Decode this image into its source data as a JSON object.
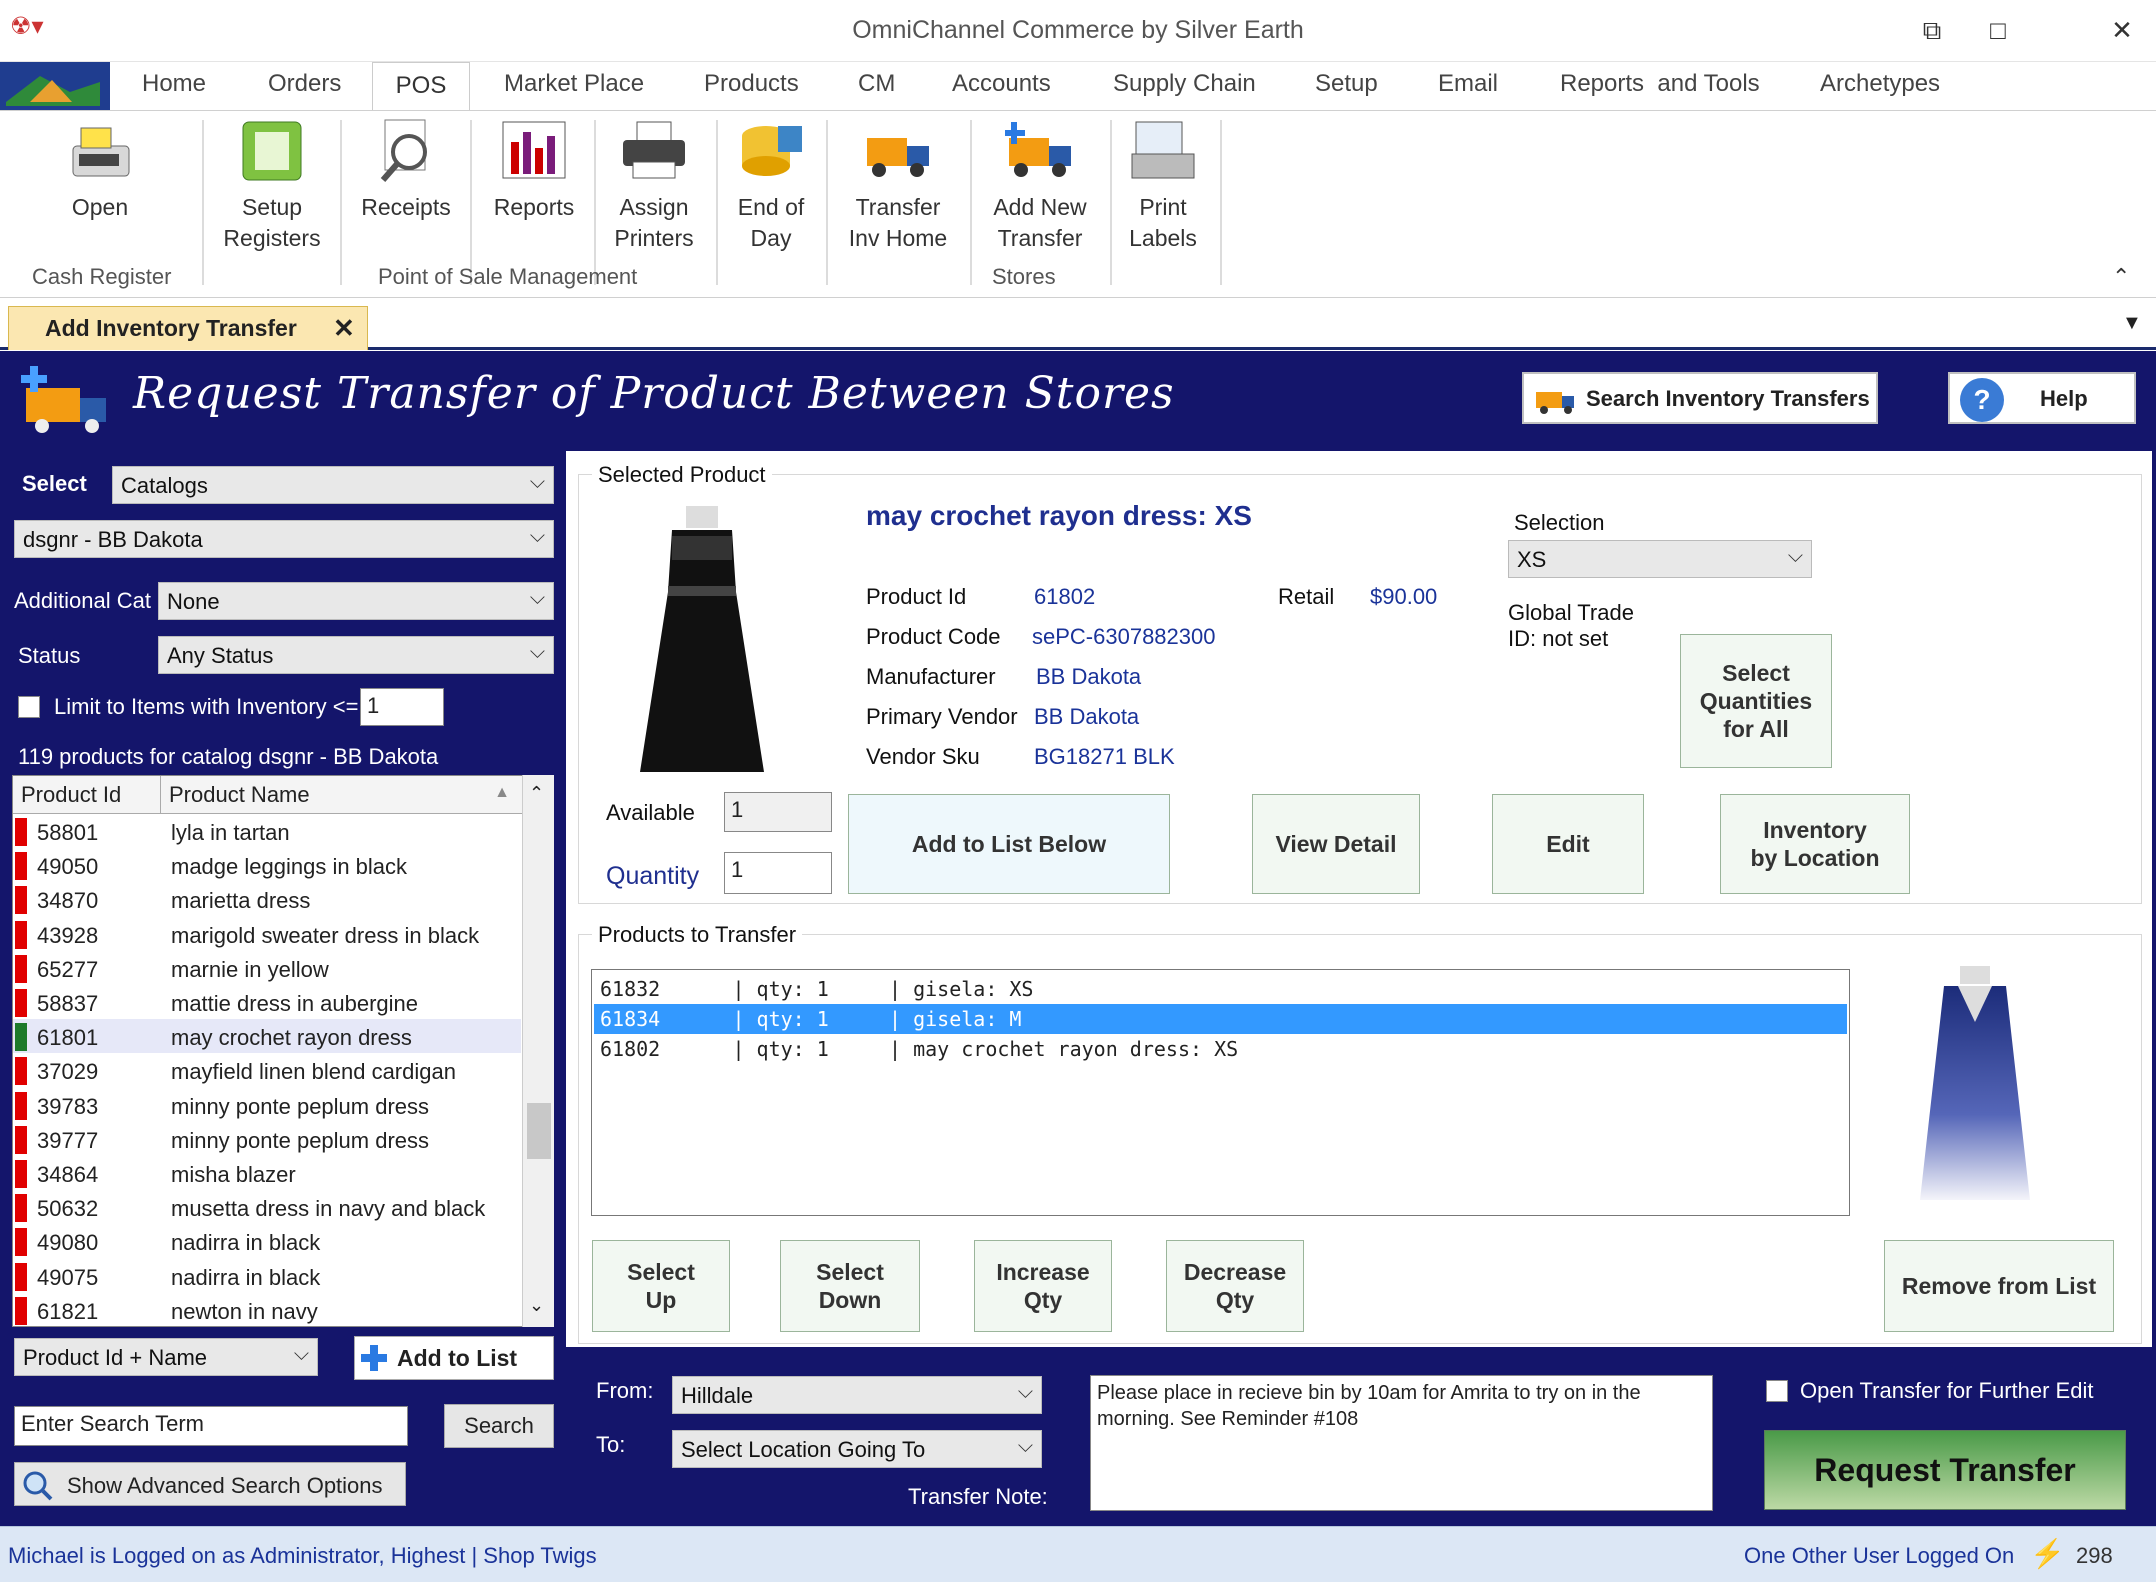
{
  "window": {
    "title": "OmniChannel Commerce by Silver Earth"
  },
  "ribbon": {
    "tabs": [
      "Home",
      "Orders",
      "POS",
      "Market Place",
      "Products",
      "CM",
      "Accounts",
      "Supply Chain",
      "Setup",
      "Email",
      "Reports  and Tools",
      "Archetypes"
    ],
    "active_tab": "POS",
    "buttons": {
      "open": "Open",
      "setup_registers": [
        "Setup",
        "Registers"
      ],
      "receipts": "Receipts",
      "reports": "Reports",
      "assign_printers": [
        "Assign",
        "Printers"
      ],
      "end_of_day": [
        "End of",
        "Day"
      ],
      "transfer_inv_home": [
        "Transfer",
        "Inv Home"
      ],
      "add_new_transfer": [
        "Add New",
        "Transfer"
      ],
      "print_labels": [
        "Print",
        "Labels"
      ]
    },
    "groups": {
      "cash_register": "Cash Register",
      "pos_management": "Point of Sale Management",
      "stores": "Stores"
    }
  },
  "doc_tab": {
    "label": "Add Inventory Transfer",
    "close": "✕"
  },
  "header": {
    "title": "Request Transfer of Product Between Stores",
    "search_transfers": "Search Inventory Transfers",
    "help": "Help"
  },
  "filters": {
    "select_label": "Select",
    "select_value": "Catalogs",
    "catalog_value": "dsgnr - BB Dakota",
    "additional_cat_label": "Additional Cat",
    "additional_cat_value": "None",
    "status_label": "Status",
    "status_value": "Any Status",
    "limit_label": "Limit to Items with Inventory <=",
    "limit_value": "1",
    "count_text": "119 products for catalog dsgnr - BB Dakota"
  },
  "product_list": {
    "columns": [
      "Product Id",
      "Product Name"
    ],
    "rows": [
      {
        "id": "58801",
        "name": "lyla in tartan",
        "flag": "#e00000"
      },
      {
        "id": "49050",
        "name": "madge leggings in black",
        "flag": "#e00000"
      },
      {
        "id": "34870",
        "name": "marietta dress",
        "flag": "#e00000"
      },
      {
        "id": "43928",
        "name": "marigold sweater dress in black",
        "flag": "#e00000"
      },
      {
        "id": "65277",
        "name": "marnie in yellow",
        "flag": "#e00000"
      },
      {
        "id": "58837",
        "name": "mattie dress in aubergine",
        "flag": "#e00000"
      },
      {
        "id": "61801",
        "name": "may crochet rayon dress",
        "flag": "#1d7a2a",
        "selected": true
      },
      {
        "id": "37029",
        "name": "mayfield linen blend cardigan",
        "flag": "#e00000"
      },
      {
        "id": "39783",
        "name": "minny ponte peplum dress",
        "flag": "#e00000"
      },
      {
        "id": "39777",
        "name": "minny ponte peplum dress",
        "flag": "#e00000"
      },
      {
        "id": "34864",
        "name": "misha blazer",
        "flag": "#e00000"
      },
      {
        "id": "50632",
        "name": "musetta dress in navy and black",
        "flag": "#e00000"
      },
      {
        "id": "49080",
        "name": "nadirra in black",
        "flag": "#e00000"
      },
      {
        "id": "49075",
        "name": "nadirra in black",
        "flag": "#e00000"
      },
      {
        "id": "61821",
        "name": "newton in navy",
        "flag": "#e00000"
      }
    ]
  },
  "search": {
    "mode": "Product Id + Name",
    "add_to_list": "Add to List",
    "term_placeholder": "Enter Search Term",
    "search_button": "Search",
    "advanced": "Show Advanced Search Options"
  },
  "selected_product": {
    "group_label": "Selected Product",
    "title": "may crochet rayon dress: XS",
    "product_id_label": "Product Id",
    "product_id": "61802",
    "retail_label": "Retail",
    "retail": "$90.00",
    "product_code_label": "Product Code",
    "product_code": "sePC-6307882300",
    "manufacturer_label": "Manufacturer",
    "manufacturer": "BB Dakota",
    "primary_vendor_label": "Primary Vendor",
    "primary_vendor": "BB Dakota",
    "vendor_sku_label": "Vendor Sku",
    "vendor_sku": "BG18271 BLK",
    "selection_label": "Selection",
    "selection_value": "XS",
    "gtid_line1": "Global Trade",
    "gtid_line2": "ID: not set",
    "select_qty_all": [
      "Select",
      "Quantities",
      "for All"
    ],
    "available_label": "Available",
    "available_value": "1",
    "quantity_label": "Quantity",
    "quantity_value": "1",
    "add_to_list_below": "Add to List Below",
    "view_detail": "View Detail",
    "edit": "Edit",
    "inventory_by_location": [
      "Inventory",
      "by Location"
    ]
  },
  "transfer_list": {
    "group_label": "Products to Transfer",
    "rows": [
      {
        "text": "61832      | qty: 1     | gisela: XS",
        "selected": false
      },
      {
        "text": "61834      | qty: 1     | gisela: M",
        "selected": true
      },
      {
        "text": "61802      | qty: 1     | may crochet rayon dress: XS",
        "selected": false
      }
    ],
    "select_up": [
      "Select",
      "Up"
    ],
    "select_down": [
      "Select",
      "Down"
    ],
    "increase_qty": [
      "Increase",
      "Qty"
    ],
    "decrease_qty": [
      "Decrease",
      "Qty"
    ],
    "remove": "Remove from List"
  },
  "transfer": {
    "from_label": "From:",
    "from_value": "Hilldale",
    "to_label": "To:",
    "to_value": "Select Location Going To",
    "note_label": "Transfer Note:",
    "note": "Please place in recieve bin by 10am for Amrita to try on in the morning. See Reminder #108",
    "open_further_edit": "Open Transfer for Further Edit",
    "request_button": "Request Transfer"
  },
  "status_bar": {
    "left": "Michael is Logged on as Administrator, Highest | Shop Twigs",
    "users": "One Other User Logged On",
    "count": "298"
  },
  "colors": {
    "navy_panel": "#14156b",
    "selection_blue": "#3399ff",
    "accent_text": "#1a3399",
    "tab_highlight": "#fbe7b1"
  }
}
